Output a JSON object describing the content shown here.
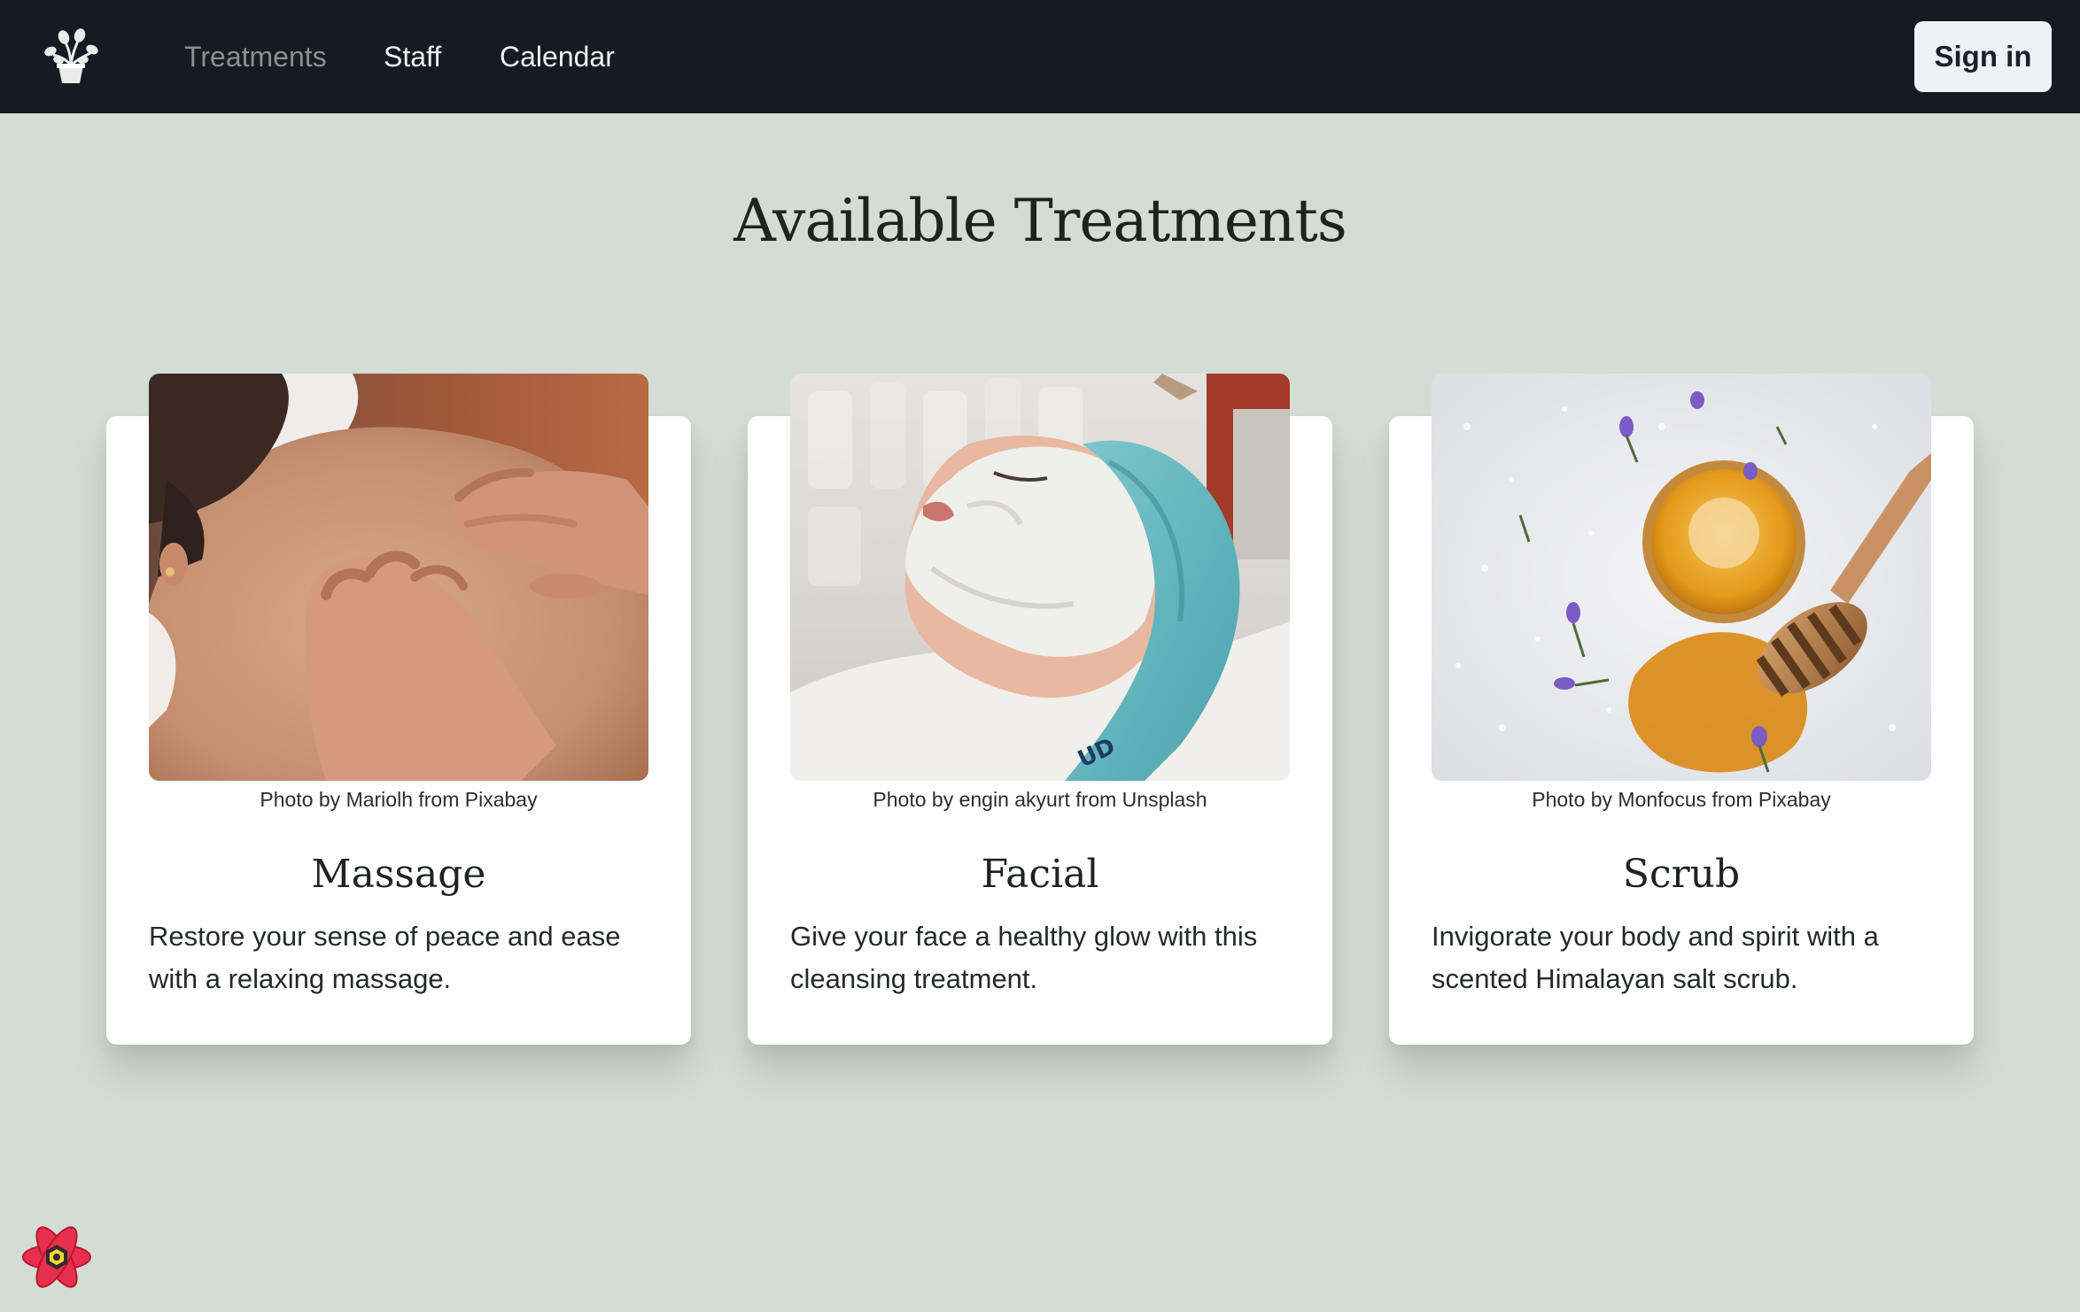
{
  "nav": {
    "logo_icon": "potted-plant-icon",
    "links": [
      {
        "label": "Treatments",
        "active": true
      },
      {
        "label": "Staff",
        "active": false
      },
      {
        "label": "Calendar",
        "active": false
      }
    ],
    "signin_label": "Sign in"
  },
  "page": {
    "title": "Available Treatments"
  },
  "treatments": [
    {
      "title": "Massage",
      "credit": "Photo by Mariolh from Pixabay",
      "description": "Restore your sense of peace and ease with a relaxing massage."
    },
    {
      "title": "Facial",
      "credit": "Photo by engin akyurt from Unsplash",
      "description": "Give your face a healthy glow with this cleansing treatment."
    },
    {
      "title": "Scrub",
      "credit": "Photo by Monfocus from Pixabay",
      "description": "Invigorate your body and spirit with a scented Himalayan salt scrub."
    }
  ],
  "devtools": {
    "icon": "react-query-devtools-icon"
  },
  "colors": {
    "navbar_bg": "#171923",
    "page_bg": "#d3ddd5",
    "card_bg": "#ffffff",
    "signin_bg": "#edf2f7",
    "nav_active": "#8d8f8f"
  }
}
